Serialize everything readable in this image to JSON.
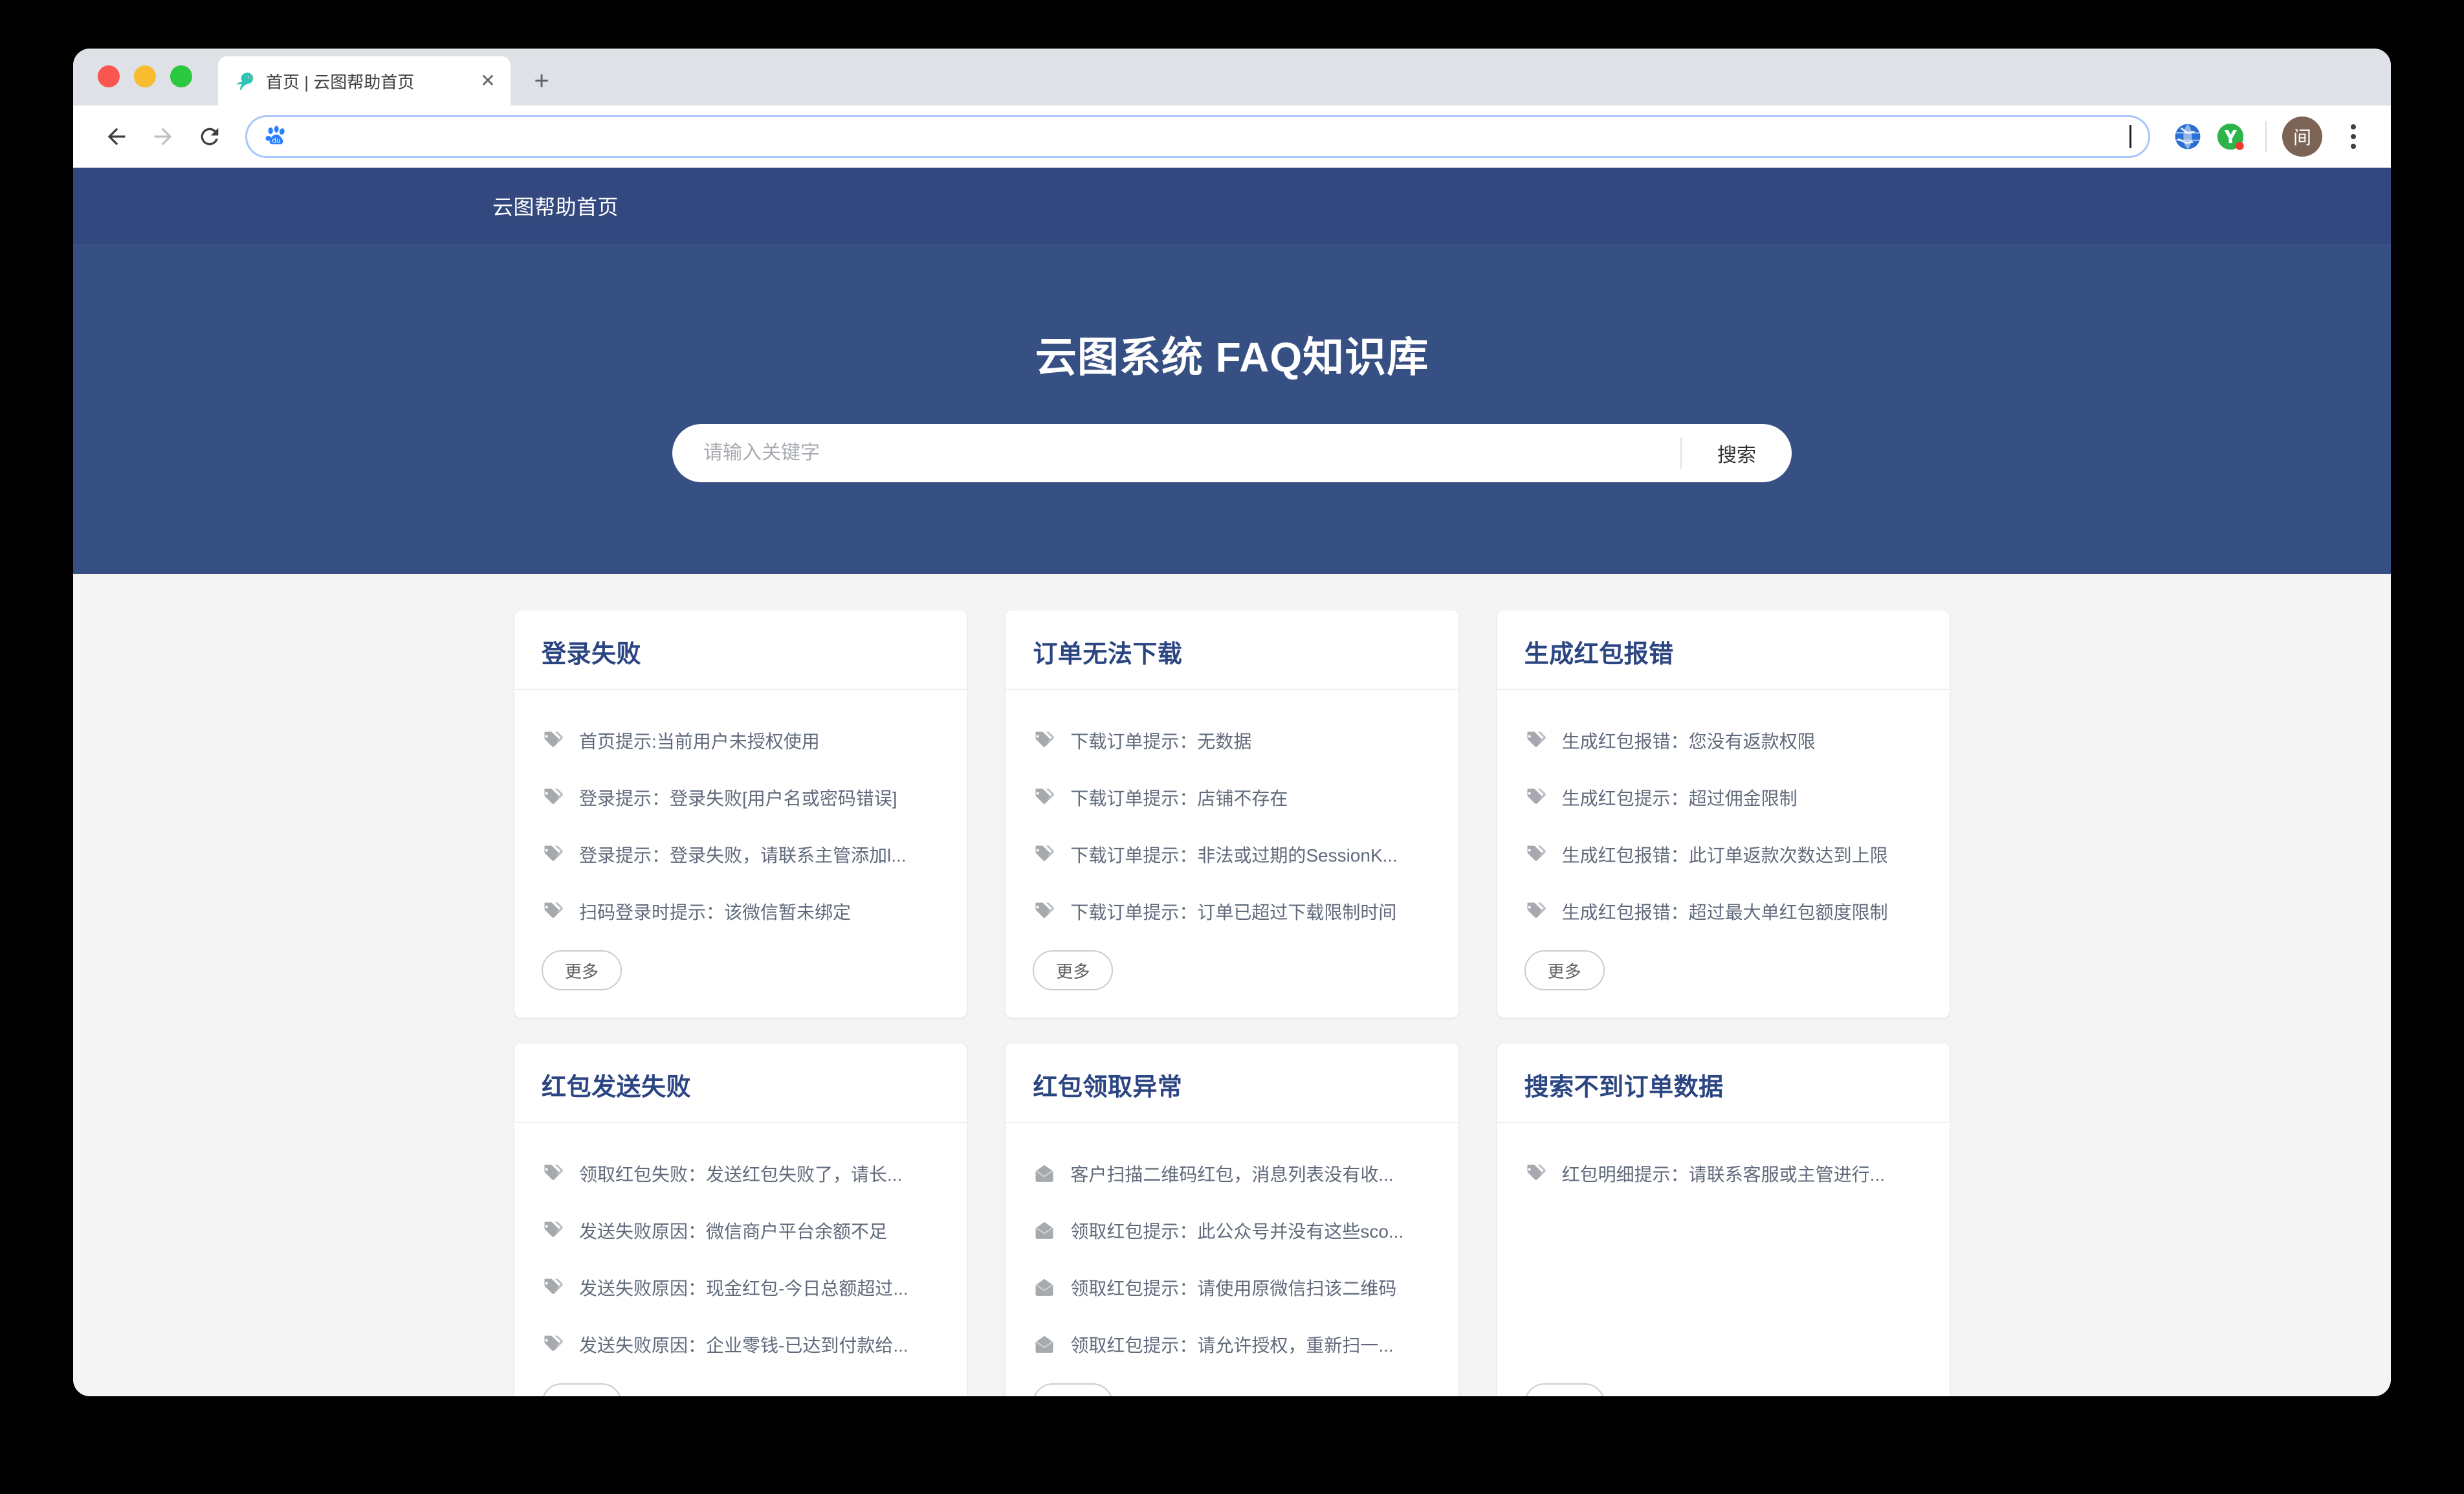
{
  "browser": {
    "tab": {
      "title": "首页 | 云图帮助首页",
      "favicon": "parrot-icon",
      "close_label": "✕"
    },
    "new_tab_label": "+",
    "toolbar": {
      "back_icon": "back-arrow-icon",
      "forward_icon": "forward-arrow-icon",
      "reload_icon": "reload-icon",
      "omnibox_value": "",
      "omnibox_icon": "baidu-paw-icon",
      "extensions": [
        "globe-extension-icon",
        "youdao-extension-icon"
      ],
      "avatar_label": "间",
      "menu_icon": "three-dot-menu-icon"
    }
  },
  "site": {
    "nav_brand": "云图帮助首页",
    "hero_title": "云图系统 FAQ知识库",
    "search": {
      "placeholder": "请输入关键字",
      "value": "",
      "button_label": "搜索"
    },
    "more_label": "更多",
    "colors": {
      "nav_blue": "#32487e",
      "hero_blue": "#375084",
      "card_title_blue": "#2b4582",
      "page_bg": "#f4f4f5"
    },
    "cards": [
      {
        "title": "登录失败",
        "icon": "tag-icon",
        "items": [
          "首页提示:当前用户未授权使用",
          "登录提示：登录失败[用户名或密码错误]",
          "登录提示：登录失败，请联系主管添加l...",
          "扫码登录时提示：该微信暂未绑定"
        ]
      },
      {
        "title": "订单无法下载",
        "icon": "tag-icon",
        "items": [
          "下载订单提示：无数据",
          "下载订单提示：店铺不存在",
          "下载订单提示：非法或过期的SessionK...",
          "下载订单提示：订单已超过下载限制时间"
        ]
      },
      {
        "title": "生成红包报错",
        "icon": "tag-icon",
        "items": [
          "生成红包报错：您没有返款权限",
          "生成红包提示：超过佣金限制",
          "生成红包报错：此订单返款次数达到上限",
          "生成红包报错：超过最大单红包额度限制"
        ]
      },
      {
        "title": "红包发送失败",
        "icon": "tag-icon",
        "items": [
          "领取红包失败：发送红包失败了，请长...",
          "发送失败原因：微信商户平台余额不足",
          "发送失败原因：现金红包-今日总额超过...",
          "发送失败原因：企业零钱-已达到付款给..."
        ]
      },
      {
        "title": "红包领取异常",
        "icon": "envelope-icon",
        "items": [
          "客户扫描二维码红包，消息列表没有收...",
          "领取红包提示：此公众号并没有这些sco...",
          "领取红包提示：请使用原微信扫该二维码",
          "领取红包提示：请允许授权，重新扫一..."
        ]
      },
      {
        "title": "搜索不到订单数据",
        "icon": "tag-icon",
        "items": [
          "红包明细提示：请联系客服或主管进行..."
        ]
      }
    ]
  }
}
